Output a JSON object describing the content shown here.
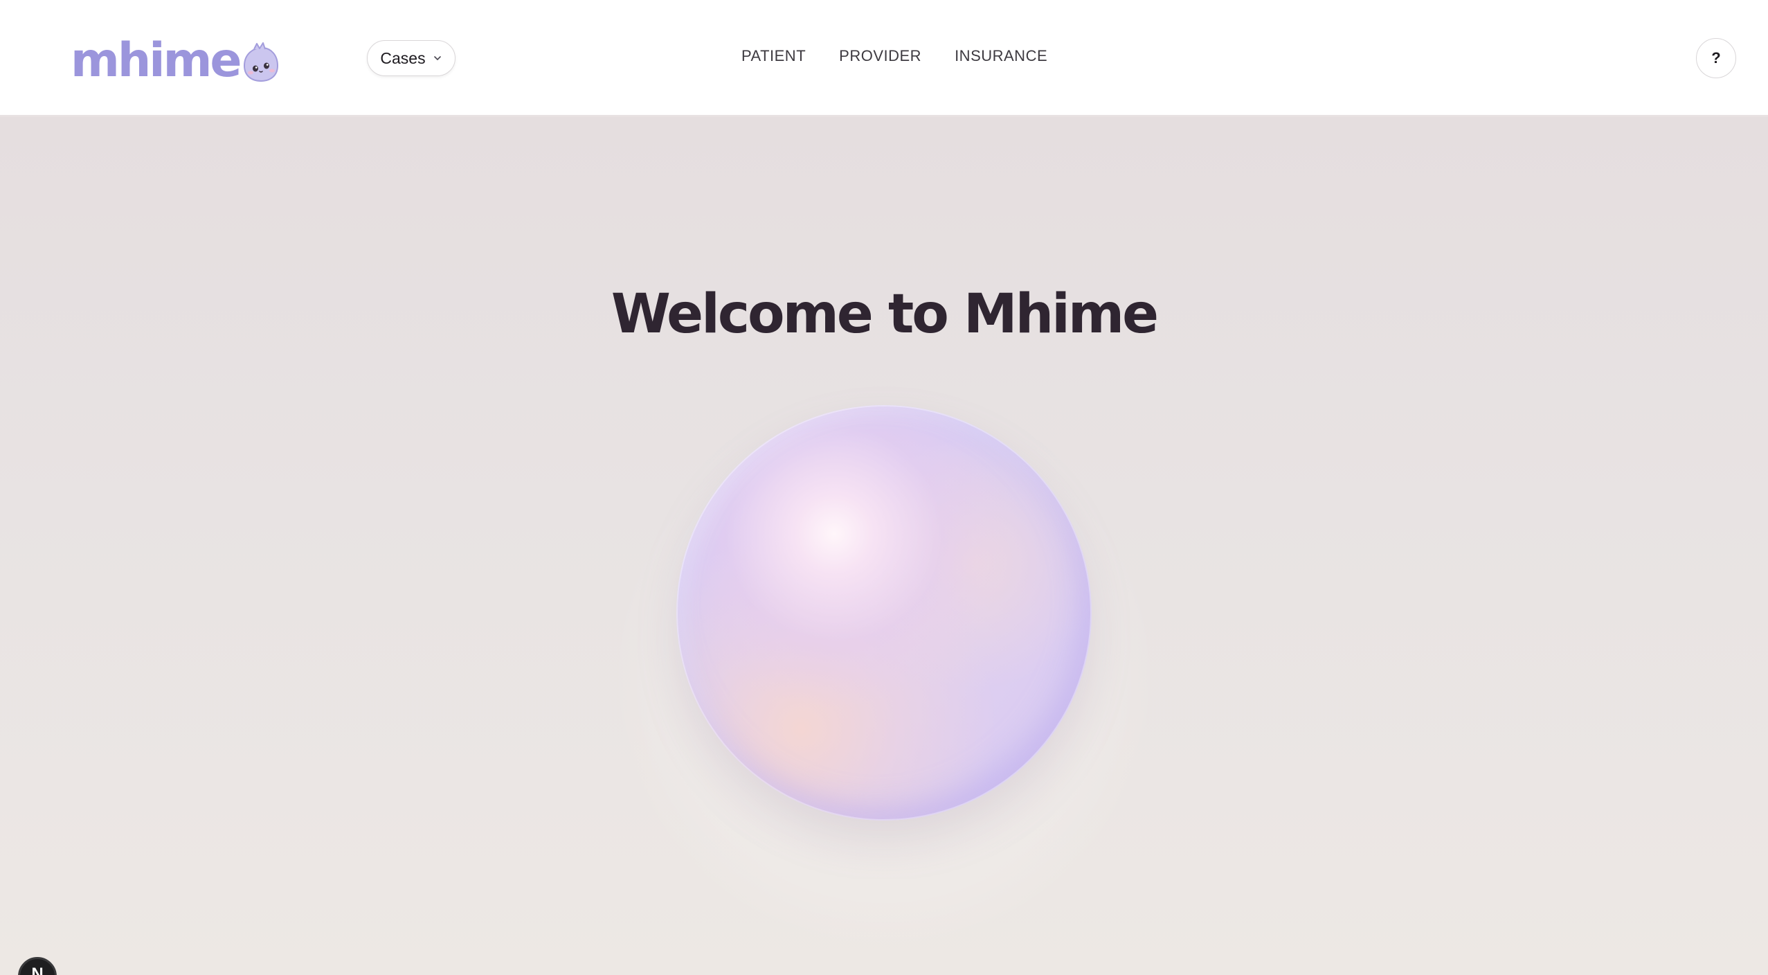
{
  "header": {
    "logo_text": "mhime",
    "cases_label": "Cases",
    "nav": [
      {
        "label": "PATIENT"
      },
      {
        "label": "PROVIDER"
      },
      {
        "label": "INSURANCE"
      }
    ],
    "help_label": "?"
  },
  "main": {
    "title": "Welcome to Mhime"
  },
  "floating_badge": {
    "label": "N"
  },
  "icons": {
    "logo_mascot": "mascot-icon",
    "cases_chevron": "chevron-down-icon"
  },
  "colors": {
    "brand": "#9b95dc",
    "title": "#2f2531",
    "background": "#e8e3e3"
  }
}
